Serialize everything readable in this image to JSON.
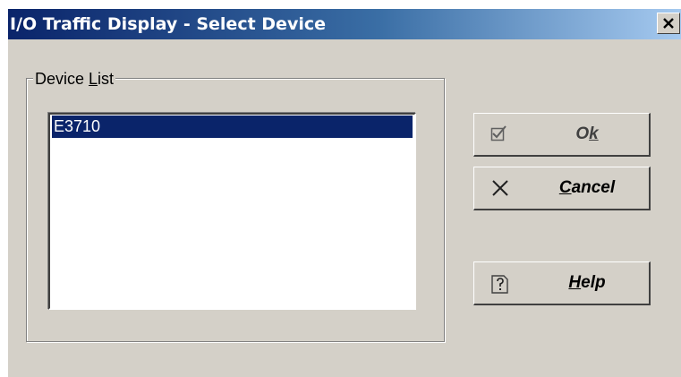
{
  "window": {
    "title": "I/O Traffic Display - Select Device",
    "close_label": "×"
  },
  "device_list": {
    "legend_before": "Device ",
    "legend_accel": "L",
    "legend_after": "ist",
    "items": [
      "E3710"
    ],
    "selected_index": 0
  },
  "buttons": {
    "ok": {
      "before": "O",
      "accel": "k",
      "after": "",
      "icon": "checkbox-check-icon",
      "enabled": false
    },
    "cancel": {
      "before": "",
      "accel": "C",
      "after": "ancel",
      "icon": "x-icon"
    },
    "help": {
      "before": "",
      "accel": "H",
      "after": "elp",
      "icon": "help-page-icon"
    }
  },
  "colors": {
    "face": "#d4d0c8",
    "title_start": "#0a246a",
    "title_end": "#a6caf0",
    "selection": "#0a246a"
  }
}
